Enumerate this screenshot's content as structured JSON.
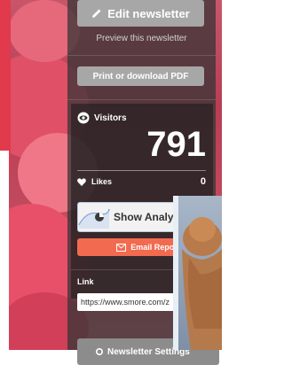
{
  "panel": {
    "edit_label": "Edit newsletter",
    "preview_label": "Preview this newsletter",
    "print_label": "Print or download PDF"
  },
  "stats": {
    "visitors_label": "Visitors",
    "visitors_count": "791",
    "likes_label": "Likes",
    "likes_count": "0"
  },
  "actions": {
    "analytics_label": "Show Analytics",
    "email_label": "Email Report"
  },
  "link": {
    "label": "Link",
    "url": "https://www.smore.com/z"
  },
  "settings": {
    "label": "Newsletter Settings"
  },
  "colors": {
    "panel_bg": "#343434",
    "accent_orange": "#f26a4f",
    "button_grey": "#a7a7a7"
  }
}
